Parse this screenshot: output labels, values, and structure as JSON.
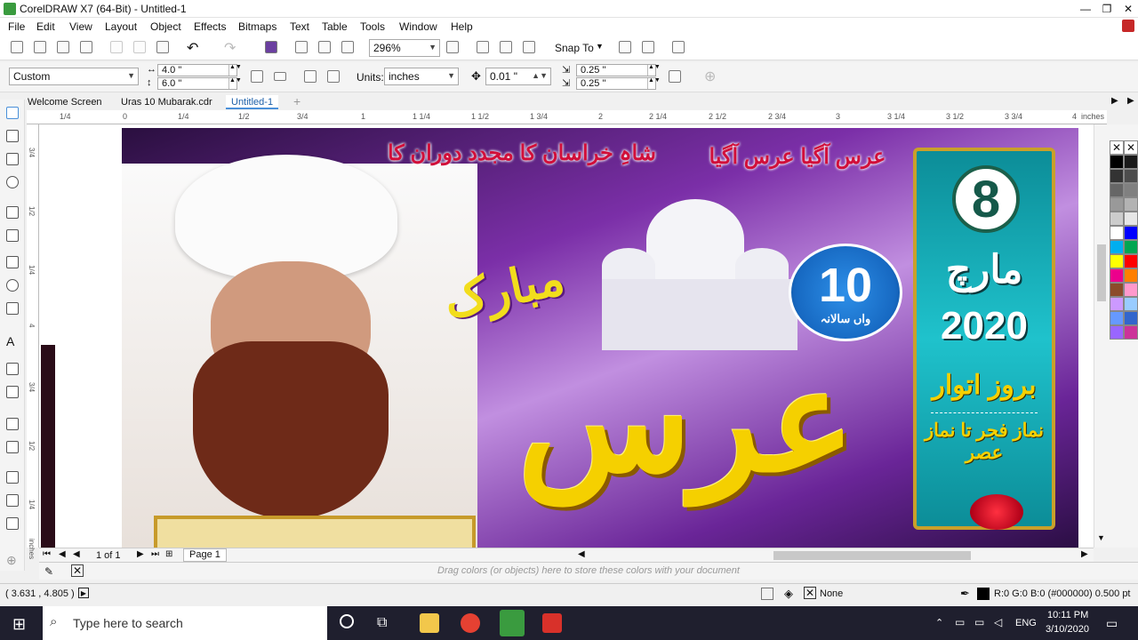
{
  "window": {
    "title": "CorelDRAW X7 (64-Bit) - Untitled-1",
    "controls": [
      "—",
      "❐",
      "✕"
    ]
  },
  "menu": [
    "File",
    "Edit",
    "View",
    "Layout",
    "Object",
    "Effects",
    "Bitmaps",
    "Text",
    "Table",
    "Tools",
    "Window",
    "Help"
  ],
  "toolbar": {
    "zoom_value": "296%",
    "snap_to": "Snap To"
  },
  "property_bar": {
    "page_size": "Custom",
    "width": "4.0 \"",
    "height": "6.0 \"",
    "units_label": "Units:",
    "units_value": "inches",
    "nudge": "0.01 \"",
    "dup_x": "0.25 \"",
    "dup_y": "0.25 \""
  },
  "tabs": [
    {
      "label": "Welcome Screen",
      "active": false
    },
    {
      "label": "Uras 10 Mubarak.cdr",
      "active": false
    },
    {
      "label": "Untitled-1",
      "active": true
    }
  ],
  "ruler": {
    "labels": [
      "1/4",
      "0",
      "1/4",
      "1/2",
      "3/4",
      "1",
      "1 1/4",
      "1 1/2",
      "1 3/4",
      "2",
      "2 1/4",
      "2 1/2",
      "2 3/4",
      "3",
      "3 1/4",
      "3 1/2",
      "3 3/4",
      "4",
      "inches"
    ]
  },
  "vruler": {
    "labels": [
      "3/4",
      "1/2",
      "1/4",
      "4",
      "3/4",
      "1/2",
      "1/4",
      "3",
      "3/4",
      "1/2",
      "inches"
    ]
  },
  "poster": {
    "headline_right": "عرس آگیا عرس آگیا",
    "headline_left": "شاہِ خراسان کا مجدد دوران کا",
    "date_day": "8",
    "date_month": "مارچ",
    "date_year": "2020",
    "weekday": "بروز اتوار",
    "timing": "نماز فجر تا نماز عصر",
    "anniversary_number": "10",
    "anniversary_text": "واں سالانہ",
    "mubarak": "مبارک",
    "urs": "عرس"
  },
  "page_nav": {
    "count": "1 of 1",
    "page_tab": "Page 1"
  },
  "docpalette_hint": "Drag colors (or objects) here to store these colors with your document",
  "status": {
    "coords": "( 3.631 , 4.805 )",
    "fill": "None",
    "outline": "R:0 G:0 B:0 (#000000)  0.500 pt"
  },
  "taskbar": {
    "search_placeholder": "Type here to search",
    "lang": "ENG",
    "time": "10:11 PM",
    "date": "3/10/2020"
  },
  "palette_colors": [
    "#000000",
    "#1a1a1a",
    "#333333",
    "#4d4d4d",
    "#666666",
    "#808080",
    "#999999",
    "#b3b3b3",
    "#cccccc",
    "#e6e6e6",
    "#ffffff",
    "#0000ff",
    "#00aeef",
    "#00a651",
    "#ffff00",
    "#ff0000",
    "#ec008c",
    "#ff7f00",
    "#8c4b2a",
    "#ff99cc",
    "#cc99ff",
    "#99ccff",
    "#6699ff",
    "#3366cc",
    "#9966ff",
    "#cc3399"
  ],
  "colors": {
    "accent_tab": "#1c5fa8",
    "urs_yellow": "#f5d000",
    "teal_banner": "#13a9b5",
    "poster_purple": "#7b2fa8",
    "blue_badge": "#1769c2"
  }
}
